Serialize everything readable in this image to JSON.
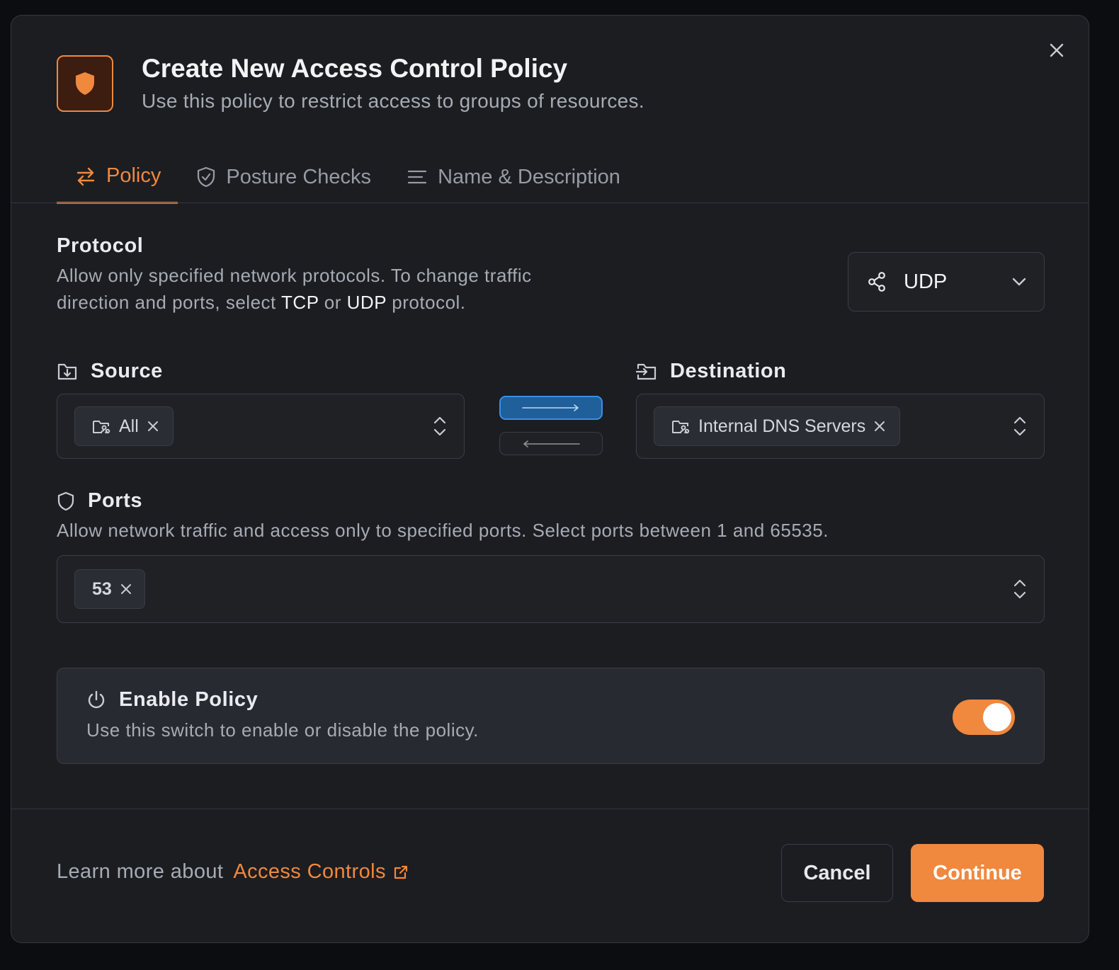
{
  "colors": {
    "accent": "#f0883e",
    "direction_active": "#3b8ee8",
    "background": "#1b1d21"
  },
  "header": {
    "icon": "shield-icon",
    "title": "Create New Access Control Policy",
    "subtitle": "Use this policy to restrict access to groups of resources.",
    "close_icon": "close-icon"
  },
  "tabs": [
    {
      "label": "Policy",
      "icon": "arrows-swap-icon",
      "active": true
    },
    {
      "label": "Posture Checks",
      "icon": "shield-check-icon",
      "active": false
    },
    {
      "label": "Name & Description",
      "icon": "text-lines-icon",
      "active": false
    }
  ],
  "protocol": {
    "title": "Protocol",
    "desc_line1": "Allow only specified network protocols. To change traffic",
    "desc_line2_pre": "direction and ports, select ",
    "desc_tcp": "TCP",
    "desc_or": " or ",
    "desc_udp": "UDP",
    "desc_post": " protocol.",
    "selected": "UDP"
  },
  "source": {
    "title": "Source",
    "chips": [
      {
        "label": "All"
      }
    ]
  },
  "destination": {
    "title": "Destination",
    "chips": [
      {
        "label": "Internal DNS Servers"
      }
    ]
  },
  "direction": {
    "outbound_active": true,
    "inbound_active": false
  },
  "ports": {
    "title": "Ports",
    "desc": "Allow network traffic and access only to specified ports. Select ports between 1 and 65535.",
    "chips": [
      {
        "label": "53"
      }
    ]
  },
  "enable": {
    "title": "Enable Policy",
    "desc": "Use this switch to enable or disable the policy.",
    "enabled": true
  },
  "footer": {
    "learn_prefix": "Learn more about",
    "learn_link": "Access Controls",
    "cancel_label": "Cancel",
    "continue_label": "Continue"
  }
}
